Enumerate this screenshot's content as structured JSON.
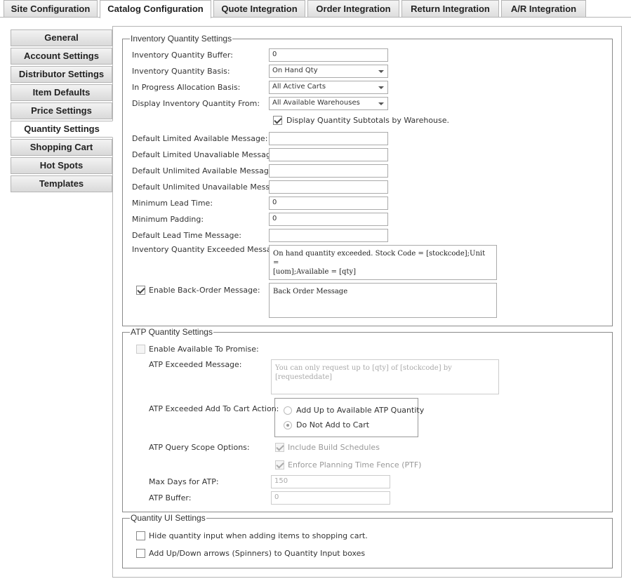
{
  "top_tabs": [
    "Site Configuration",
    "Catalog Configuration",
    "Quote Integration",
    "Order Integration",
    "Return Integration",
    "A/R Integration"
  ],
  "side_menu": [
    "General",
    "Account Settings",
    "Distributor Settings",
    "Item Defaults",
    "Price Settings",
    "Quantity Settings",
    "Shopping Cart",
    "Hot Spots",
    "Templates"
  ],
  "inventory": {
    "legend": "Inventory Quantity Settings",
    "buffer_label": "Inventory Quantity Buffer:",
    "buffer_value": "0",
    "basis_label": "Inventory Quantity Basis:",
    "basis_value": "On Hand Qty",
    "alloc_label": "In Progress Allocation Basis:",
    "alloc_value": "All Active Carts",
    "display_label": "Display Inventory Quantity From:",
    "display_value": "All Available Warehouses",
    "subtotals_label": "Display Quantity Subtotals by Warehouse.",
    "lim_avail_label": "Default Limited Available Message:",
    "lim_unavail_label": "Default Limited Unavaliable Message:",
    "unlim_avail_label": "Default Unlimited Available Message:",
    "unlim_unavail_label": "Default Unlimited Unavailable Message:",
    "min_lead_label": "Minimum Lead Time:",
    "min_lead_value": "0",
    "min_pad_label": "Minimum Padding:",
    "min_pad_value": "0",
    "lead_msg_label": "Default Lead Time Message:",
    "exceeded_label": "Inventory Quantity Exceeded Message",
    "exceeded_value": "On hand quantity exceeded. Stock Code = [stockcode];Unit =\n[uom];Available = [qty]",
    "backorder_label": "Enable Back-Order Message:",
    "backorder_value": "Back Order Message"
  },
  "atp": {
    "legend": "ATP Quantity Settings",
    "enable_label": "Enable Available To Promise:",
    "exceeded_label": "ATP Exceeded Message:",
    "exceeded_value": "You can only request up to [qty] of [stockcode] by [requesteddate]",
    "action_label": "ATP Exceeded Add To Cart Action:",
    "action_opt1": "Add Up to Available ATP Quantity",
    "action_opt2": "Do Not Add to Cart",
    "scope_label": "ATP Query Scope Options:",
    "scope_opt1": "Include Build Schedules",
    "scope_opt2": "Enforce Planning Time Fence (PTF)",
    "max_days_label": "Max Days for ATP:",
    "max_days_value": "150",
    "buffer_label": "ATP Buffer:",
    "buffer_value": "0"
  },
  "qui": {
    "legend": "Quantity UI Settings",
    "hide_label": "Hide quantity input when adding items to shopping cart.",
    "spinner_label": "Add Up/Down arrows (Spinners) to Quantity Input boxes"
  },
  "colors": {
    "border": "#b5b5b5",
    "group_border": "#8a8a8a"
  }
}
